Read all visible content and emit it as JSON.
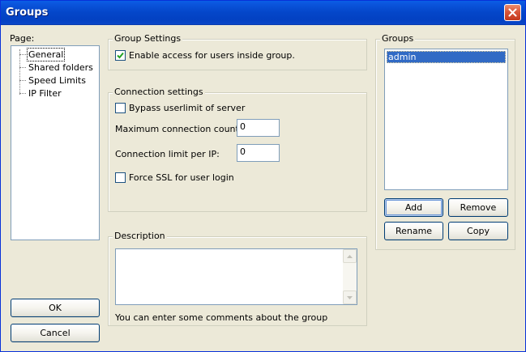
{
  "window": {
    "title": "Groups"
  },
  "page_panel": {
    "label": "Page:",
    "items": [
      {
        "label": "General",
        "selected": true
      },
      {
        "label": "Shared folders",
        "selected": false
      },
      {
        "label": "Speed Limits",
        "selected": false
      },
      {
        "label": "IP Filter",
        "selected": false
      }
    ]
  },
  "group_settings": {
    "title": "Group Settings",
    "enable_access": {
      "label": "Enable access for users inside group.",
      "checked": true
    }
  },
  "connection_settings": {
    "title": "Connection settings",
    "bypass_userlimit": {
      "label": "Bypass userlimit of server",
      "checked": false
    },
    "max_connection_count": {
      "label": "Maximum connection count:",
      "value": "0"
    },
    "connection_limit_per_ip": {
      "label": "Connection limit per IP:",
      "value": "0"
    },
    "force_ssl": {
      "label": "Force SSL for user login",
      "checked": false
    }
  },
  "description": {
    "title": "Description",
    "value": "",
    "hint": "You can enter some comments about the group"
  },
  "groups_panel": {
    "title": "Groups",
    "items": [
      {
        "label": "admin",
        "selected": true
      }
    ],
    "buttons": {
      "add": "Add",
      "remove": "Remove",
      "rename": "Rename",
      "copy": "Copy"
    }
  },
  "footer": {
    "ok": "OK",
    "cancel": "Cancel"
  },
  "colors": {
    "titlebar": "#0446c9",
    "selection": "#316ac5",
    "face": "#ece9d8"
  }
}
